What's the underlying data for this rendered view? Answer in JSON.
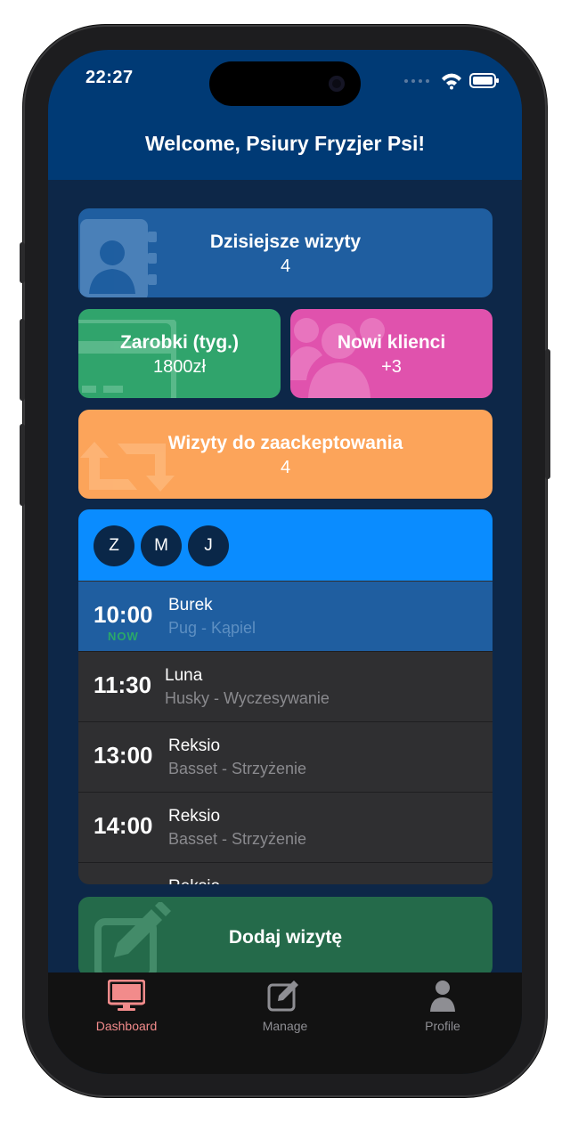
{
  "status": {
    "time": "22:27"
  },
  "header": {
    "welcome": "Welcome, Psiury Fryzjer Psi!"
  },
  "cards": {
    "today": {
      "title": "Dzisiejsze wizyty",
      "value": "4",
      "color": "#1f5ea0",
      "icon": "contact-book-icon"
    },
    "earnings": {
      "title": "Zarobki (tyg.)",
      "value": "1800zł",
      "color": "#30a46c",
      "icon": "credit-card-icon"
    },
    "new_clients": {
      "title": "Nowi klienci",
      "value": "+3",
      "color": "#e052ad",
      "icon": "users-icon"
    },
    "pending": {
      "title": "Wizyty do zaackeptowania",
      "value": "4",
      "color": "#fca45a",
      "icon": "retweet-icon"
    }
  },
  "schedule": {
    "staff": [
      "Z",
      "M",
      "J"
    ],
    "appointments": [
      {
        "time": "10:00",
        "badge": "NOW",
        "name": "Burek",
        "detail": "Pug - Kąpiel",
        "active": true
      },
      {
        "time": "11:30",
        "name": "Luna",
        "detail": "Husky - Wyczesywanie"
      },
      {
        "time": "13:00",
        "name": "Reksio",
        "detail": "Basset - Strzyżenie"
      },
      {
        "time": "14:00",
        "name": "Reksio",
        "detail": "Basset - Strzyżenie"
      },
      {
        "time": "",
        "name": "Reksio",
        "detail": ""
      }
    ]
  },
  "add_button": {
    "label": "Dodaj wizytę",
    "icon": "pencil-square-icon"
  },
  "tabs": [
    {
      "label": "Dashboard",
      "icon": "desktop-icon",
      "active": true,
      "color": "#f28b8b"
    },
    {
      "label": "Manage",
      "icon": "edit-icon",
      "active": false,
      "color": "#8e8e93"
    },
    {
      "label": "Profile",
      "icon": "user-icon",
      "active": false,
      "color": "#8e8e93"
    }
  ]
}
